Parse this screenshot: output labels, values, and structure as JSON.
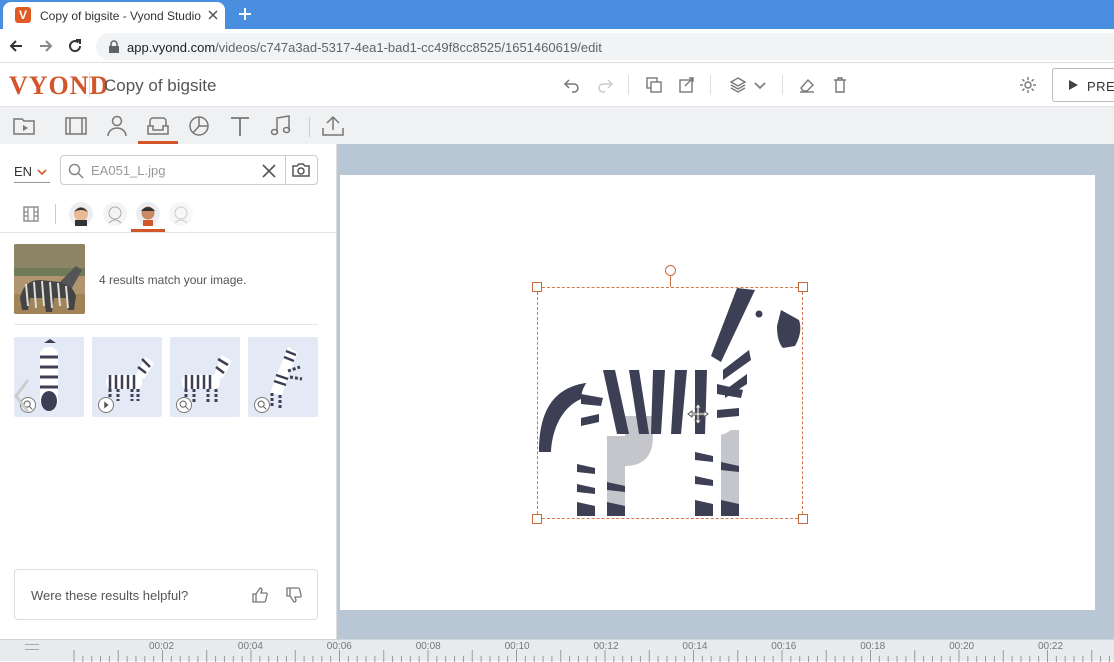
{
  "browser": {
    "tab_title": "Copy of bigsite - Vyond Studio",
    "tab_favicon_letter": "V",
    "url_host": "app.vyond.com",
    "url_path": "/videos/c747a3ad-5317-4ea1-bad1-cc49f8cc8525/1651460619/edit"
  },
  "app": {
    "logo": "VYOND",
    "project_title": "Copy of bigsite",
    "preview_label": "PRE",
    "accent_color": "#d2562b"
  },
  "library_tabs": [
    {
      "name": "templates-icon"
    },
    {
      "name": "film-icon"
    },
    {
      "name": "character-icon"
    },
    {
      "name": "props-icon",
      "active": true
    },
    {
      "name": "charts-icon"
    },
    {
      "name": "text-icon"
    },
    {
      "name": "music-icon"
    },
    {
      "name": "upload-icon"
    }
  ],
  "panel": {
    "language": "EN",
    "search_value": "EA051_L.jpg",
    "result_message": "4 results match your image.",
    "feedback_question": "Were these results helpful?"
  },
  "timeline": {
    "labels": [
      "00:02",
      "00:04",
      "00:06",
      "00:08",
      "00:10",
      "00:12",
      "00:14",
      "00:16",
      "00:18",
      "00:20",
      "00:22"
    ]
  }
}
